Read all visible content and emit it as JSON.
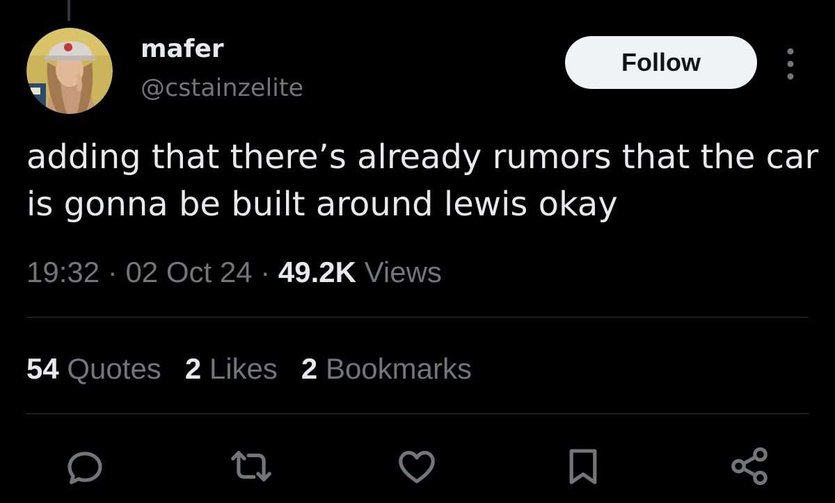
{
  "author": {
    "display_name": "mafer",
    "handle": "@cstainzelite",
    "avatar_icon": "user-avatar-photo"
  },
  "header": {
    "follow_label": "Follow",
    "more_icon": "more-vertical-icon"
  },
  "tweet": {
    "text": "adding that there’s already rumors that the car is gonna be built around lewis okay",
    "time": "19:32",
    "separator": "·",
    "date": "02 Oct 24",
    "views_count": "49.2K",
    "views_label": "Views"
  },
  "stats": {
    "quotes_count": "54",
    "quotes_label": "Quotes",
    "likes_count": "2",
    "likes_label": "Likes",
    "bookmarks_count": "2",
    "bookmarks_label": "Bookmarks"
  },
  "actions": [
    "reply-icon",
    "retweet-icon",
    "like-icon",
    "bookmark-icon",
    "share-icon"
  ],
  "colors": {
    "background": "#000000",
    "primary_text": "#e7e9ea",
    "secondary_text": "#71767b",
    "divider": "#2f3336",
    "follow_button_bg": "#eff3f4",
    "follow_button_text": "#0f1419"
  }
}
